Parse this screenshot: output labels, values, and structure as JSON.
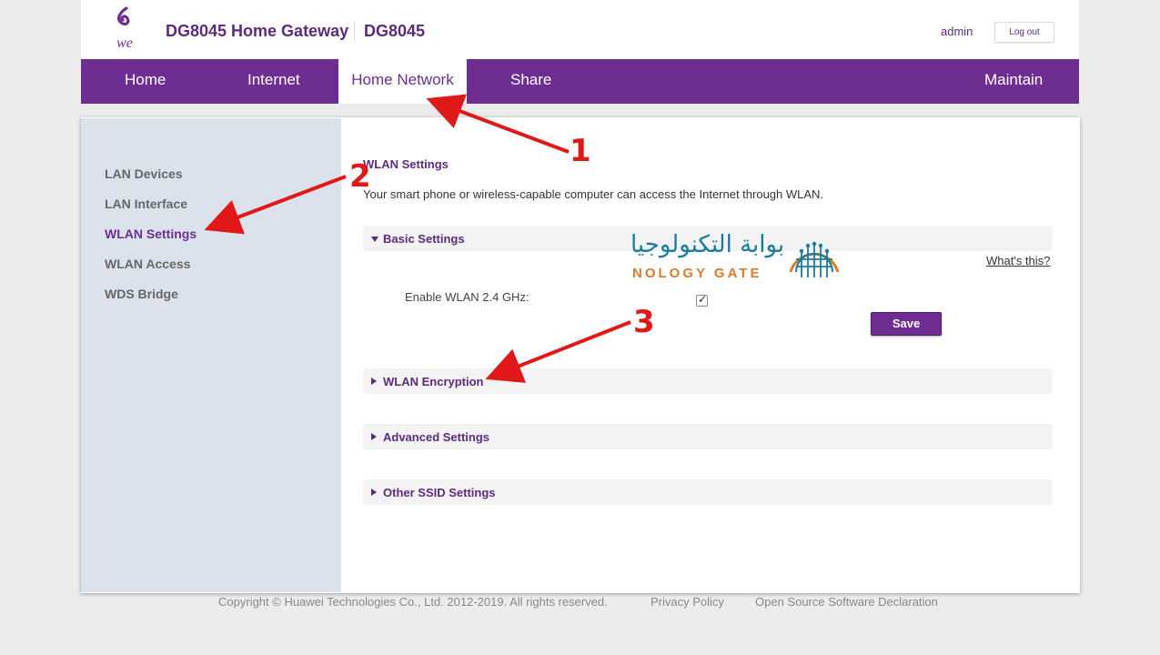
{
  "header": {
    "title": "DG8045 Home Gateway",
    "model": "DG8045",
    "user": "admin",
    "logout_label": "Log out",
    "logo_text": "we"
  },
  "nav": {
    "items": [
      {
        "label": "Home"
      },
      {
        "label": "Internet"
      },
      {
        "label": "Home Network",
        "active": true
      },
      {
        "label": "Share"
      },
      {
        "label": "Maintain"
      }
    ]
  },
  "sidebar": {
    "items": [
      {
        "label": "LAN Devices"
      },
      {
        "label": "LAN Interface"
      },
      {
        "label": "WLAN Settings",
        "active": true
      },
      {
        "label": "WLAN Access"
      },
      {
        "label": "WDS Bridge"
      }
    ]
  },
  "main": {
    "title": "WLAN Settings",
    "description": "Your smart phone or wireless-capable computer can access the Internet through WLAN.",
    "whats_this": "What's this?",
    "sections": [
      {
        "label": "Basic Settings",
        "expanded": true
      },
      {
        "label": "WLAN Encryption",
        "expanded": false
      },
      {
        "label": "Advanced Settings",
        "expanded": false
      },
      {
        "label": "Other SSID Settings",
        "expanded": false
      }
    ],
    "enable_wlan_label": "Enable WLAN 2.4 GHz:",
    "enable_wlan_checked": true,
    "save_label": "Save"
  },
  "watermark": {
    "arabic": "بوابة التكنولوجيا",
    "english": "NOLOGY GATE"
  },
  "annotations": {
    "n1": "1",
    "n2": "2",
    "n3": "3"
  },
  "footer": {
    "copyright": "Copyright © Huawei Technologies Co., Ltd. 2012-2019. All rights reserved.",
    "privacy": "Privacy Policy",
    "open_source": "Open Source Software Declaration"
  },
  "colors": {
    "brand_purple": "#6e2d91",
    "sidebar_bg": "#dce2ec",
    "annotation_red": "#e01818"
  }
}
